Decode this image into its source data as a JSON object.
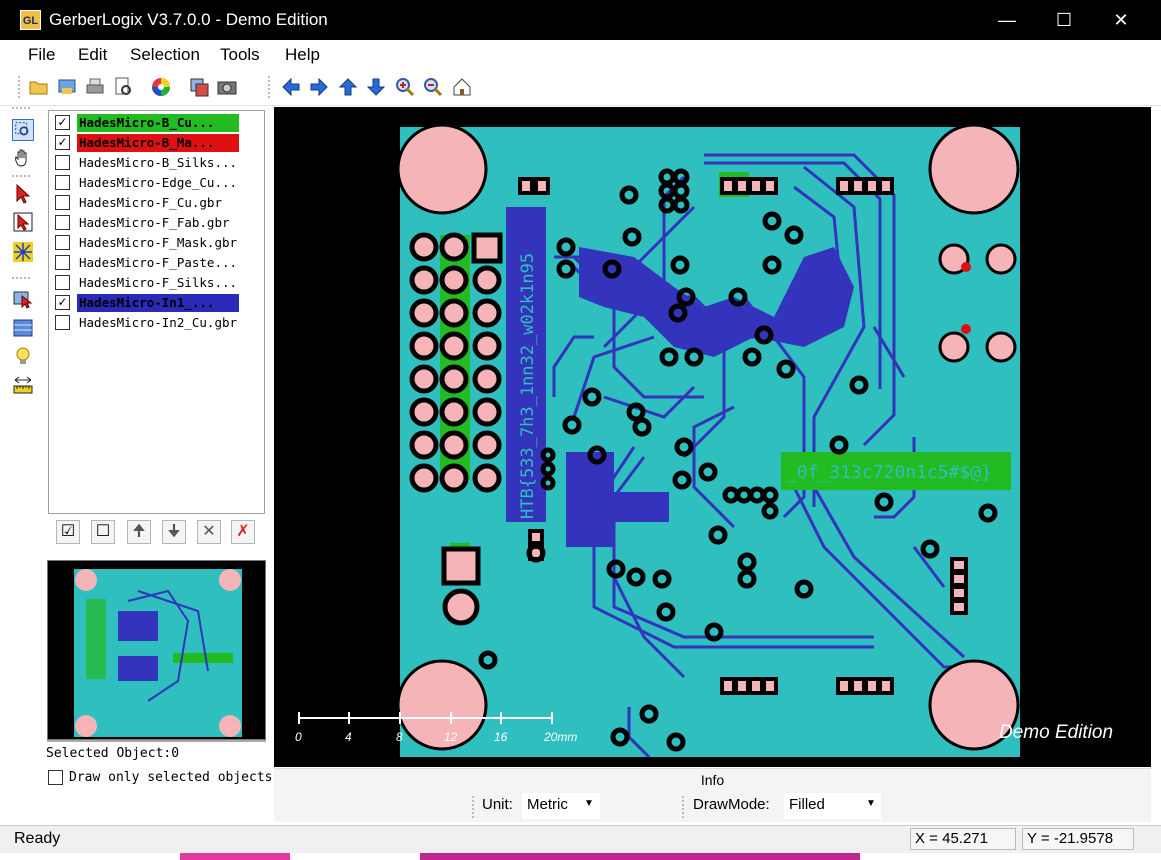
{
  "window": {
    "title": "GerberLogix V3.7.0.0  -  Demo Edition",
    "icon_text": "GL",
    "minimize": "—",
    "maximize": "☐",
    "close": "✕"
  },
  "menu": [
    "File",
    "Edit",
    "Selection",
    "Tools",
    "Help"
  ],
  "toolbar_icons": [
    "open-folder-icon",
    "export-icon",
    "print-icon",
    "print-preview-icon",
    "color-wheel-icon",
    "layer-copy-icon",
    "camera-icon",
    "arrow-left-icon",
    "arrow-right-icon",
    "arrow-up-icon",
    "arrow-down-icon",
    "zoom-in-icon",
    "zoom-out-icon",
    "home-icon"
  ],
  "left_tools": [
    "zoom-window-icon",
    "pan-hand-icon",
    "select-arrow-icon",
    "select-box-icon",
    "net-highlight-icon",
    "measure-icon",
    "layer-panel-icon",
    "bulb-icon",
    "measure-ruler-icon"
  ],
  "layers": [
    {
      "name": "HadesMicro-B_Cu...",
      "checked": true,
      "color": "#22bb22"
    },
    {
      "name": "HadesMicro-B_Ma...",
      "checked": true,
      "color": "#e01010"
    },
    {
      "name": "HadesMicro-B_Silks...",
      "checked": false,
      "color": ""
    },
    {
      "name": "HadesMicro-Edge_Cu...",
      "checked": false,
      "color": ""
    },
    {
      "name": "HadesMicro-F_Cu.gbr",
      "checked": false,
      "color": ""
    },
    {
      "name": "HadesMicro-F_Fab.gbr",
      "checked": false,
      "color": ""
    },
    {
      "name": "HadesMicro-F_Mask.gbr",
      "checked": false,
      "color": ""
    },
    {
      "name": "HadesMicro-F_Paste...",
      "checked": false,
      "color": ""
    },
    {
      "name": "HadesMicro-F_Silks...",
      "checked": false,
      "color": ""
    },
    {
      "name": "HadesMicro-In1_...",
      "checked": true,
      "color": "#2a2ab8"
    },
    {
      "name": "HadesMicro-In2_Cu.gbr",
      "checked": false,
      "color": ""
    }
  ],
  "layer_buttons": [
    "check-all-icon",
    "uncheck-all-icon",
    "move-up-icon",
    "move-down-icon",
    "remove-icon",
    "delete-icon"
  ],
  "selected_object": "Selected Object:0",
  "draw_selected": {
    "label": "Draw only selected objects",
    "checked": false
  },
  "pcb": {
    "vertical_text": "HTB{533_7h3_1nn32_w02k1n95",
    "horizontal_text": "_0f_313c720n1c5#$@}",
    "watermark": "Demo Edition",
    "scale_labels": [
      "0",
      "4",
      "8",
      "12",
      "16",
      "20mm"
    ],
    "colors": {
      "board": "#2fbfbf",
      "inner": "#3333bb",
      "copper": "#22bb22",
      "pad": "#f5b5b8",
      "background": "#000000"
    }
  },
  "info": {
    "label": "Info"
  },
  "options": {
    "unit_label": "Unit:",
    "unit_value": "Metric",
    "drawmode_label": "DrawMode:",
    "drawmode_value": "Filled"
  },
  "status": {
    "text": "Ready",
    "x": "X = 45.271",
    "y": "Y = -21.9578"
  }
}
